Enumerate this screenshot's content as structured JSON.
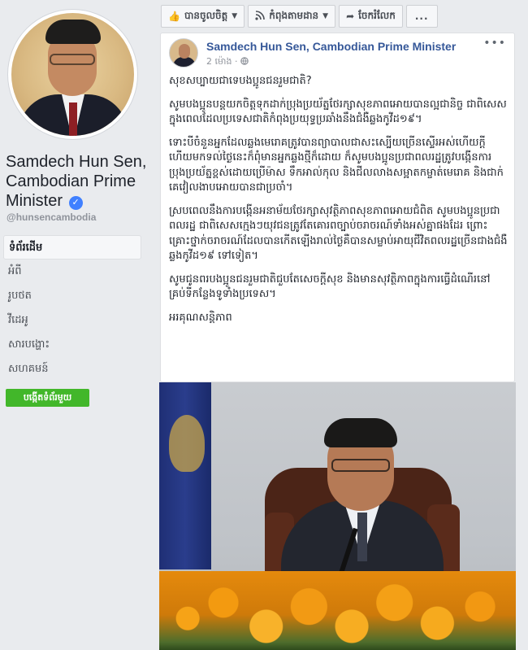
{
  "profile": {
    "name": "Samdech Hun Sen, Cambodian Prime Minister",
    "verified_icon": "verified-check-icon",
    "handle": "@hunsencambodia"
  },
  "nav": {
    "items": [
      {
        "label": "ទំព័រដើម",
        "active": true
      },
      {
        "label": "អំពី",
        "active": false
      },
      {
        "label": "រូបថត",
        "active": false
      },
      {
        "label": "វីដេអូ",
        "active": false
      },
      {
        "label": "សារបង្ហោះ",
        "active": false
      },
      {
        "label": "សហគមន៍",
        "active": false
      }
    ],
    "create_page_label": "បង្កើតទំព័រមួយ"
  },
  "actions": {
    "like": {
      "label": "បានចូលចិត្ត",
      "icon": "thumbs-up-icon"
    },
    "follow": {
      "label": "កំពុងតាមដាន",
      "icon": "rss-icon"
    },
    "share": {
      "label": "ចែករំលែក",
      "icon": "share-arrow-icon"
    },
    "more": {
      "label": "...",
      "icon": "more-icon"
    }
  },
  "post": {
    "author": "Samdech Hun Sen, Cambodian Prime Minister",
    "time": "2 ម៉ោង",
    "audience_icon": "globe-icon",
    "paragraphs": [
      "សុខសប្បាយជាទេបងប្អូនជនរួមជាតិ?",
      "សូមបងប្អូនបន្តយកចិត្តទុកដាក់ប្រុងប្រយ័ត្នថែរក្សាសុខភាពអោយបានល្អជានិច្ច ជាពិសេសក្នុងពេលដែលប្រទេសជាតិកំពុងប្រយុទ្ធប្រឆាំងនឹងជំងឺឆ្លងកូវីដ១៩។",
      "ទោះបីចំនួនអ្នកដែលឆ្លងមេរោគត្រូវបានព្យាបាលជាសះស្បើយច្រើនស្ទើរអស់ហើយក្តី ហើយមកទល់ថ្ងៃនេះក៏ពុំមានអ្នកឆ្លងថ្មីក៏ដោយ ក៏សូមបងប្អូនប្រជាពលរដ្ឋត្រូវបង្កើនការប្រុងប្រយ័ត្នខ្ពស់ដោយប្រើម៉ាស ទឹកអាល់កុល និងជីលលាងសម្អាតកម្ចាត់មេរោគ និងជាក់គេវៀលងាបអោយបានជាប្រចាំ។",
      "ស្របពេលនឹងការបង្កើនអនាម័យថែរក្សាសុវត្ថិភាពសុខភាពអោយជំពិត សូមបងប្អូនប្រជាពលរដ្ឋ ជាពិសេសក្មេងៗយុវជនត្រូវតែគោរពច្បាប់ចរាចរណ៍ទាំងអស់គ្នាផងដែរ ព្រោះគ្រោះថ្នាក់ចរាចរណ៍ដែលបានកើតឡើងរាល់ថ្ងៃគឺបានសម្លាប់អាយុជីវិតពលរដ្ឋច្រើនជាងជំងឺឆ្លងកូវីដ១៩ ទៅទៀត។",
      "សូមជូនពរបងប្អូនជនរួមជាតិជួបតែសេចក្តីសុខ និងមានសុវត្ថិភាពក្នុងការធ្វើដំណើរនៅគ្រប់ទីកន្លែងទូទាំងប្រទេស។",
      "អរគុណសន្តិភាព"
    ]
  },
  "colors": {
    "link_blue": "#365899",
    "create_green": "#42b72a",
    "page_bg": "#e9ebee"
  }
}
